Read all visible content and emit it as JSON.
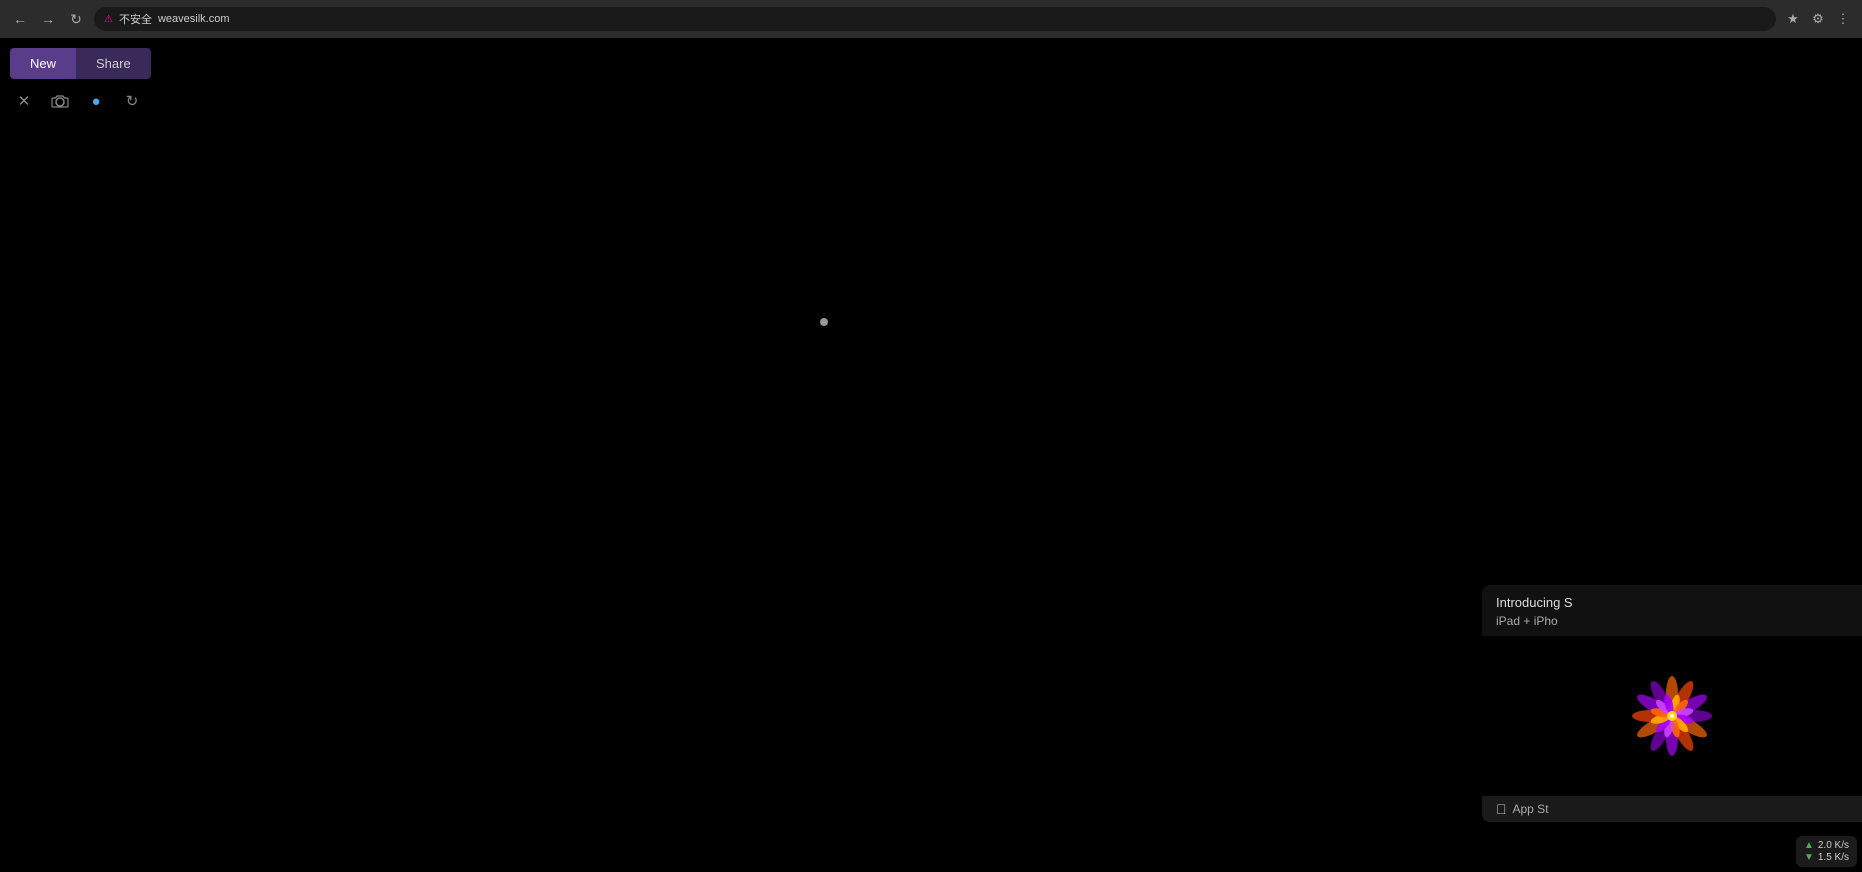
{
  "browser": {
    "tab_label": "weavesilk.com",
    "security_label": "不安全",
    "url": "weavesilk.com",
    "nav": {
      "back": "←",
      "forward": "→",
      "reload": "↻"
    }
  },
  "toolbar": {
    "new_label": "New",
    "share_label": "Share",
    "tools": [
      {
        "name": "cross-icon",
        "symbol": "✕",
        "active": false
      },
      {
        "name": "camera-icon",
        "symbol": "⊙",
        "active": false
      },
      {
        "name": "circle-icon",
        "symbol": "●",
        "active": true
      },
      {
        "name": "reset-icon",
        "symbol": "↺",
        "active": false
      }
    ]
  },
  "popup": {
    "title": "Introducing S",
    "subtitle": "iPad + iPho",
    "footer_label": "App St"
  },
  "network": {
    "download": "1.5 K/s",
    "upload": "2.0 K/s"
  }
}
